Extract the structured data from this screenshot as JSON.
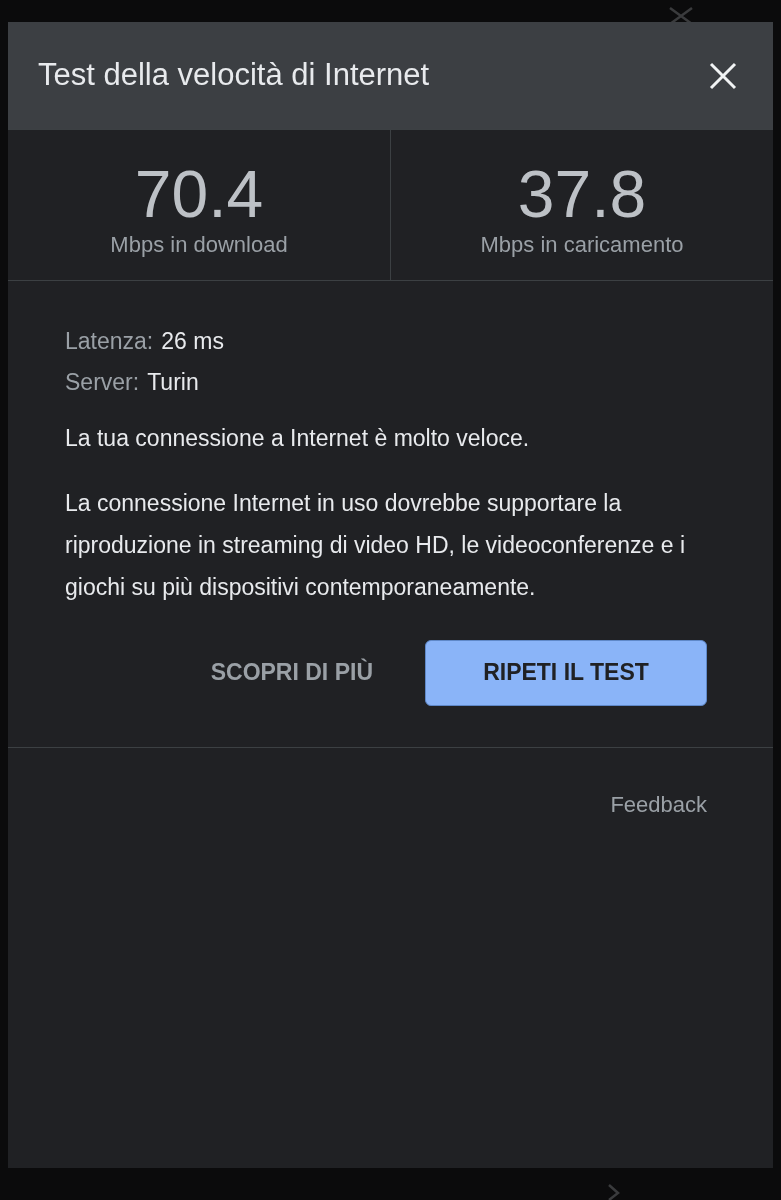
{
  "dialog": {
    "title": "Test della velocità di Internet",
    "stats": [
      {
        "value": "70.4",
        "label": "Mbps in download"
      },
      {
        "value": "37.8",
        "label": "Mbps in caricamento"
      }
    ],
    "details": [
      {
        "label": "Latenza:",
        "value": "26 ms"
      },
      {
        "label": "Server:",
        "value": "Turin"
      }
    ],
    "summary": "La tua connessione a Internet è molto veloce.",
    "description": "La connessione Internet in uso dovrebbe supportare la riproduzione in streaming di video HD, le videoconferenze e i giochi su più dispositivi contemporaneamente.",
    "buttons": [
      {
        "label": "SCOPRI DI PIÙ",
        "kind": "text"
      },
      {
        "label": "RIPETI IL TEST",
        "kind": "primary"
      }
    ],
    "feedback": "Feedback"
  }
}
